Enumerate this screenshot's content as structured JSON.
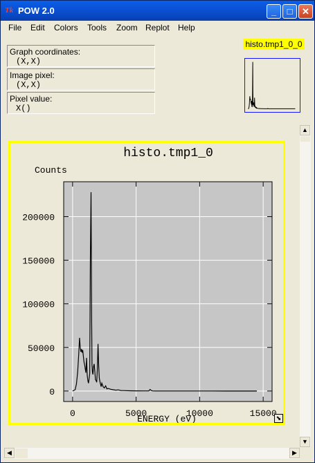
{
  "window": {
    "title": "POW 2.0",
    "icon_glyph": "Tk",
    "minimize_glyph": "_",
    "maximize_glyph": "□",
    "close_glyph": "✕"
  },
  "menu": [
    "File",
    "Edit",
    "Colors",
    "Tools",
    "Zoom",
    "Replot",
    "Help"
  ],
  "coords": {
    "graph_label": "Graph coordinates:",
    "graph_value": "(X,X)",
    "image_label": "Image pixel:",
    "image_value": "(X,X)",
    "pixel_label": "Pixel value:",
    "pixel_value": "X()"
  },
  "thumbnail": {
    "label": "histo.tmp1_0_0"
  },
  "scroll": {
    "up": "▲",
    "down": "▼",
    "left": "◀",
    "right": "▶"
  },
  "chart_data": {
    "type": "line",
    "title": "histo.tmp1_0",
    "xlabel": "ENERGY  (eV)",
    "ylabel": "Counts",
    "xlim": [
      -700,
      15700
    ],
    "ylim": [
      -12000,
      240000
    ],
    "grid": true,
    "x_ticks": [
      0,
      5000,
      10000,
      15000
    ],
    "x_tick_labels": [
      "0",
      "5000",
      "10000",
      "15000"
    ],
    "y_ticks": [
      0,
      50000,
      100000,
      150000,
      200000
    ],
    "y_tick_labels": [
      "0",
      "50000",
      "100000",
      "150000",
      "200000"
    ],
    "series": [
      {
        "color": "#000000",
        "x": [
          0,
          200,
          300,
          400,
          480,
          550,
          600,
          650,
          700,
          750,
          800,
          850,
          900,
          950,
          1000,
          1050,
          1100,
          1150,
          1200,
          1250,
          1300,
          1350,
          1400,
          1450,
          1500,
          1530,
          1560,
          1600,
          1650,
          1700,
          1750,
          1800,
          1850,
          1900,
          1950,
          2000,
          2050,
          2100,
          2150,
          2200,
          2250,
          2300,
          2400,
          2500,
          2600,
          2700,
          2800,
          3000,
          3200,
          3400,
          3600,
          3800,
          4000,
          4500,
          5000,
          5500,
          6000,
          6100,
          6200,
          6300,
          6500,
          7000,
          8000,
          9000,
          10000,
          11000,
          12000,
          13000,
          14000,
          14500
        ],
        "y": [
          0,
          1500,
          8000,
          22000,
          42000,
          61000,
          50000,
          45000,
          48000,
          44000,
          47000,
          40000,
          33000,
          30000,
          25000,
          21000,
          38000,
          18000,
          12000,
          9000,
          14000,
          20000,
          150000,
          228000,
          80000,
          30000,
          22000,
          19000,
          28000,
          31000,
          22000,
          13000,
          12000,
          10000,
          25000,
          54000,
          30000,
          15000,
          11000,
          8000,
          5000,
          9000,
          5000,
          3500,
          6000,
          2500,
          3000,
          2000,
          1500,
          1000,
          1300,
          600,
          500,
          300,
          200,
          100,
          100,
          1800,
          500,
          100,
          60,
          40,
          30,
          20,
          10,
          10,
          5,
          5,
          0,
          0
        ]
      }
    ]
  }
}
